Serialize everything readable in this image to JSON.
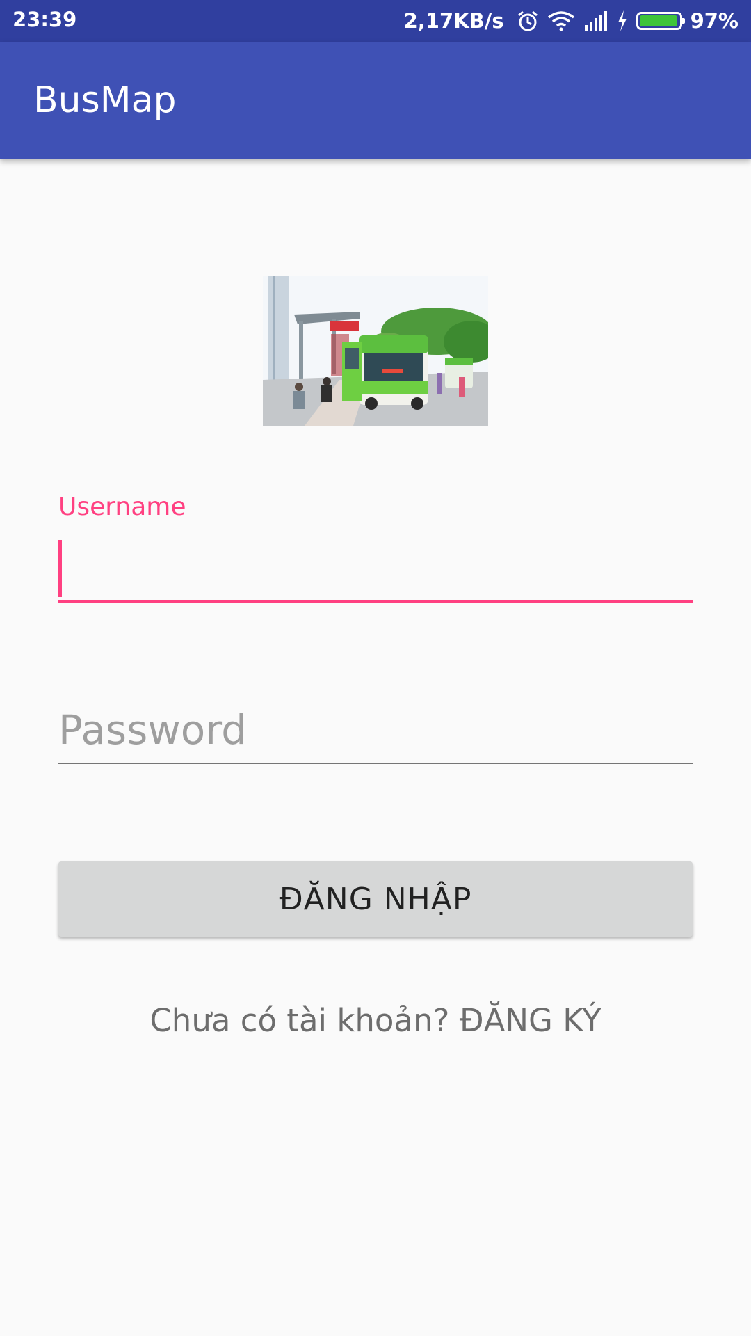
{
  "status_bar": {
    "time": "23:39",
    "network_speed": "2,17KB/s",
    "battery_percent": "97%",
    "battery_level": 0.97,
    "icons": [
      "alarm-icon",
      "wifi-icon",
      "signal-icon",
      "charging-icon",
      "battery-icon"
    ]
  },
  "app_bar": {
    "title": "BusMap"
  },
  "hero_image": {
    "depicts": "green bus at a bus stop"
  },
  "login_form": {
    "username_label": "Username",
    "username_value": "",
    "password_placeholder": "Password",
    "password_value": "",
    "login_button_label": "ĐĂNG NHẬP"
  },
  "register_prompt": "Chưa có tài khoản? ĐĂNG KÝ",
  "colors": {
    "status_bar": "#303f9f",
    "app_bar": "#3f51b5",
    "accent": "#ff4081",
    "button": "#d6d7d7",
    "background": "#fafafa"
  }
}
